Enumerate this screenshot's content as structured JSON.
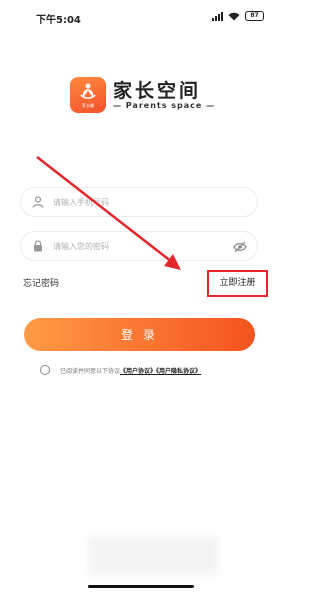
{
  "status_bar": {
    "time": "下午5:04",
    "battery": "87"
  },
  "app": {
    "logo_caption": "家长端",
    "title": "家长空间",
    "subtitle": "— Parents  space —"
  },
  "login_form": {
    "phone_placeholder": "请输入手机号码",
    "password_placeholder": "请输入您的密码",
    "forgot_password": "忘记密码",
    "register": "立即注册",
    "login_button": "登 录"
  },
  "agreement": {
    "prefix": "已阅读并同意以下协议",
    "user_agreement": "《用户协议》",
    "privacy_agreement": "《用户隐私协议》"
  },
  "colors": {
    "accent": "#f4541f",
    "annotation_red": "#e3262a"
  }
}
